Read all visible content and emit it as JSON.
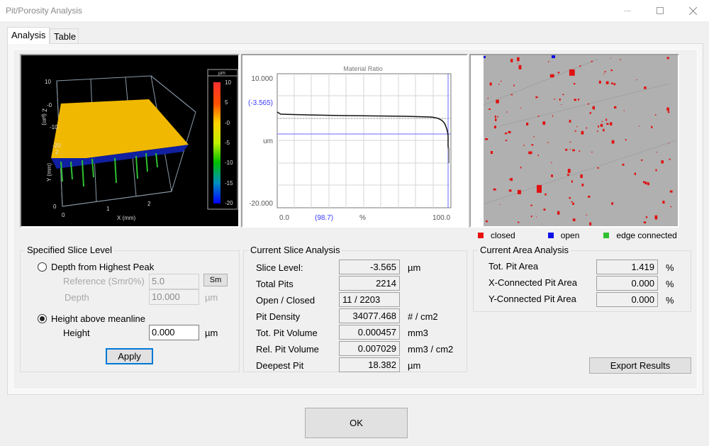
{
  "window": {
    "title": "Pit/Porosity Analysis",
    "minimize_icon": "minimize-icon",
    "maximize_icon": "maximize-icon",
    "close_icon": "close-icon"
  },
  "tabs": [
    {
      "label": "Analysis",
      "active": true
    },
    {
      "label": "Table",
      "active": false
    }
  ],
  "view3d": {
    "z_axis_label": "Z (µm)",
    "y_axis_label": "Y (mm)",
    "x_axis_label": "X (mm)",
    "z_ticks": [
      "10",
      "-0",
      "-10",
      "-20"
    ],
    "y_ticks": [
      "2",
      "0"
    ],
    "x_ticks": [
      "0",
      "1",
      "2"
    ],
    "colorbar_unit": "µm",
    "colorbar_ticks": [
      "10",
      "5",
      "-0",
      "-5",
      "-10",
      "-15",
      "-20"
    ]
  },
  "material_ratio": {
    "title": "Material Ratio",
    "y_top": "10.000",
    "y_bottom": "-20.000",
    "y_unit": "um",
    "slice_marker": "(-3.565)",
    "x_left": "0.0",
    "x_marker": "(98.7)",
    "x_unit": "%",
    "x_right": "100.0",
    "marker_color": "#3a3aff"
  },
  "pit_map": {
    "legend": [
      {
        "label": "closed",
        "color": "#e81010"
      },
      {
        "label": "open",
        "color": "#1010e8"
      },
      {
        "label": "edge connected",
        "color": "#30c030"
      }
    ]
  },
  "slice_level": {
    "title": "Specified Slice Level",
    "depth_option": {
      "label": "Depth from Highest Peak",
      "selected": false
    },
    "reference_label": "Reference (Smr0%)",
    "reference_value": "5.0",
    "sm_button": "Sm",
    "depth_label": "Depth",
    "depth_value": "10.000",
    "depth_unit": "µm",
    "height_option": {
      "label": "Height above meanline",
      "selected": true
    },
    "height_label": "Height",
    "height_value": "0.000",
    "height_unit": "µm",
    "apply_button": "Apply"
  },
  "slice_analysis": {
    "title": "Current Slice Analysis",
    "rows": [
      {
        "label": "Slice Level:",
        "value": "-3.565",
        "unit": "µm"
      },
      {
        "label": "Total Pits",
        "value": "2214",
        "unit": ""
      },
      {
        "label": "Open / Closed",
        "value": "11  /  2203",
        "unit": ""
      },
      {
        "label": "Pit Density",
        "value": "34077.468",
        "unit": "# / cm2"
      },
      {
        "label": "Tot. Pit Volume",
        "value": "0.000457",
        "unit": "mm3"
      },
      {
        "label": "Rel. Pit Volume",
        "value": "0.007029",
        "unit": "mm3 / cm2"
      },
      {
        "label": "Deepest Pit",
        "value": "18.382",
        "unit": "µm"
      }
    ]
  },
  "area_analysis": {
    "title": "Current Area Analysis",
    "rows": [
      {
        "label": "Tot. Pit Area",
        "value": "1.419",
        "unit": "%"
      },
      {
        "label": "X-Connected Pit Area",
        "value": "0.000",
        "unit": "%"
      },
      {
        "label": "Y-Connected Pit Area",
        "value": "0.000",
        "unit": "%"
      }
    ],
    "export_button": "Export Results"
  },
  "ok_button": "OK"
}
